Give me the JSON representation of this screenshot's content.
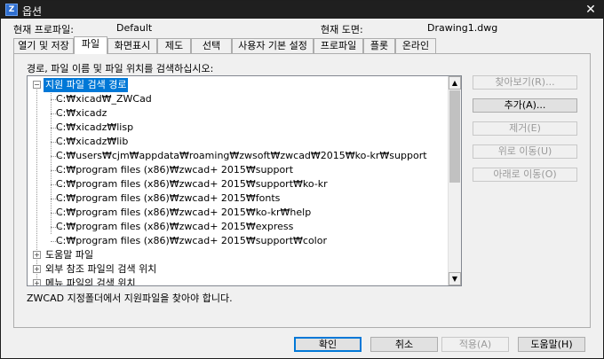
{
  "window": {
    "title": "옵션",
    "app_icon_text": "Z",
    "close_glyph": "✕"
  },
  "info": {
    "current_profile_label": "현재 프로파일:",
    "current_profile_value": "Default",
    "current_drawing_label": "현재 도면:",
    "current_drawing_value": "Drawing1.dwg"
  },
  "tabs": [
    {
      "label": "열기 및 저장"
    },
    {
      "label": "파일"
    },
    {
      "label": "화면표시"
    },
    {
      "label": "제도"
    },
    {
      "label": "선택"
    },
    {
      "label": "사용자 기본 설정"
    },
    {
      "label": "프로파일"
    },
    {
      "label": "플롯"
    },
    {
      "label": "온라인"
    }
  ],
  "files_tab": {
    "prompt": "경로, 파일 이름 및 파일 위치를 검색하십시오:",
    "tree": {
      "root_label": "지원 파일 검색 경로",
      "paths": [
        "C:₩xicad₩_ZWCad",
        "C:₩xicadz",
        "C:₩xicadz₩lisp",
        "C:₩xicadz₩lib",
        "C:₩users₩cjm₩appdata₩roaming₩zwsoft₩zwcad₩2015₩ko-kr₩support",
        "C:₩program files (x86)₩zwcad+ 2015₩support",
        "C:₩program files (x86)₩zwcad+ 2015₩support₩ko-kr",
        "C:₩program files (x86)₩zwcad+ 2015₩fonts",
        "C:₩program files (x86)₩zwcad+ 2015₩ko-kr₩help",
        "C:₩program files (x86)₩zwcad+ 2015₩express",
        "C:₩program files (x86)₩zwcad+ 2015₩support₩color"
      ],
      "other_nodes": [
        "도움말 파일",
        "외부 참조 파일의 검색 위치",
        "메뉴 파일의 검색 위치"
      ]
    },
    "side_buttons": {
      "browse": "찾아보기(R)...",
      "add": "추가(A)...",
      "remove": "제거(E)",
      "move_up": "위로 이동(U)",
      "move_down": "아래로 이동(O)"
    },
    "note": "ZWCAD 지정폴더에서 지원파일을 찾아야 합니다."
  },
  "buttons": {
    "ok": "확인",
    "cancel": "취소",
    "apply": "적용(A)",
    "help": "도움말(H)"
  }
}
